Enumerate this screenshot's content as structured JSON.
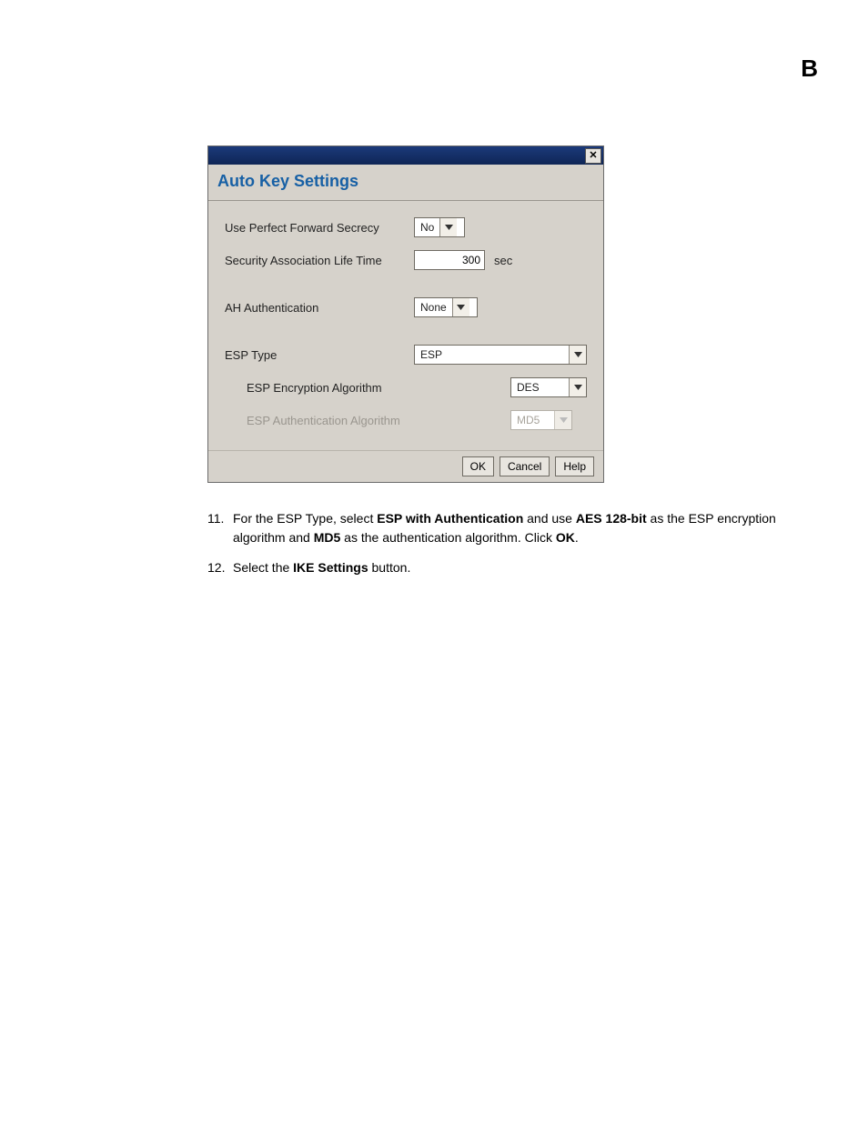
{
  "page_letter": "B",
  "dialog": {
    "title": "Auto Key Settings",
    "close_glyph": "✕",
    "fields": {
      "pfs_label": "Use Perfect Forward Secrecy",
      "pfs_value": "No",
      "salt_label": "Security Association Life Time",
      "salt_value": "300",
      "salt_unit": "sec",
      "ah_label": "AH Authentication",
      "ah_value": "None",
      "esp_type_label": "ESP Type",
      "esp_type_value": "ESP",
      "esp_enc_label": "ESP Encryption Algorithm",
      "esp_enc_value": "DES",
      "esp_auth_label": "ESP Authentication Algorithm",
      "esp_auth_value": "MD5"
    },
    "buttons": {
      "ok": "OK",
      "cancel": "Cancel",
      "help": "Help"
    }
  },
  "steps": {
    "s11": {
      "num": "11.",
      "pre": "For the ESP Type, select ",
      "b1": "ESP with Authentication",
      "mid1": " and use ",
      "b2": "AES 128-bit",
      "mid2": " as the ESP encryption algorithm and ",
      "b3": "MD5",
      "mid3": " as the authentication algorithm. Click ",
      "b4": "OK",
      "post": "."
    },
    "s12": {
      "num": "12.",
      "pre": "Select the ",
      "b1": "IKE Settings",
      "post": " button."
    }
  }
}
